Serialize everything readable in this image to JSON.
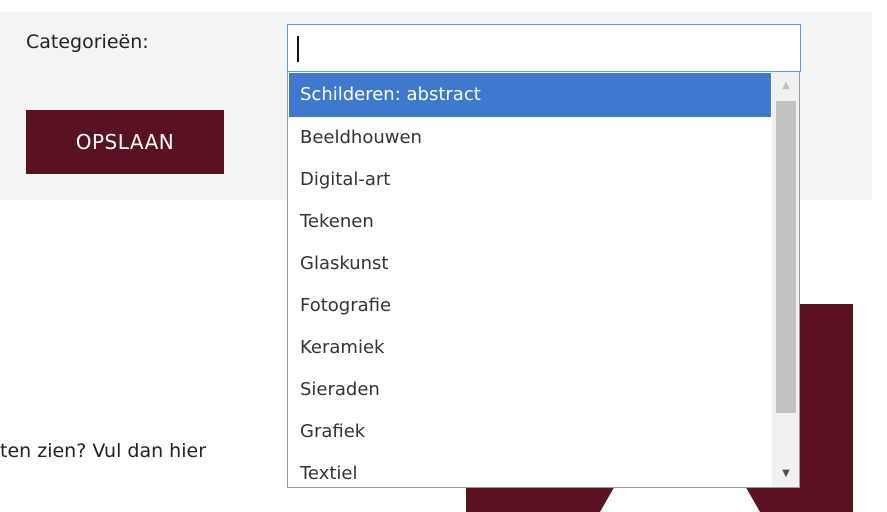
{
  "form": {
    "label": "Categorieën:",
    "save_label": "OPSLAAN",
    "input_value": ""
  },
  "dropdown": {
    "options": [
      "Schilderen: abstract",
      "Beeldhouwen",
      "Digital-art",
      "Tekenen",
      "Glaskunst",
      "Fotografie",
      "Keramiek",
      "Sieraden",
      "Grafiek",
      "Textiel"
    ],
    "highlighted_option": "Schilderen: abstract"
  },
  "background": {
    "text": "ten zien? Vul dan hier"
  },
  "icons": {
    "scroll_up": "scroll-up-arrow-icon",
    "scroll_down": "scroll-down-arrow-icon"
  },
  "colors": {
    "brand": "#5a1222",
    "highlight": "#3f78cf",
    "focus_border": "#5b9dd9"
  }
}
